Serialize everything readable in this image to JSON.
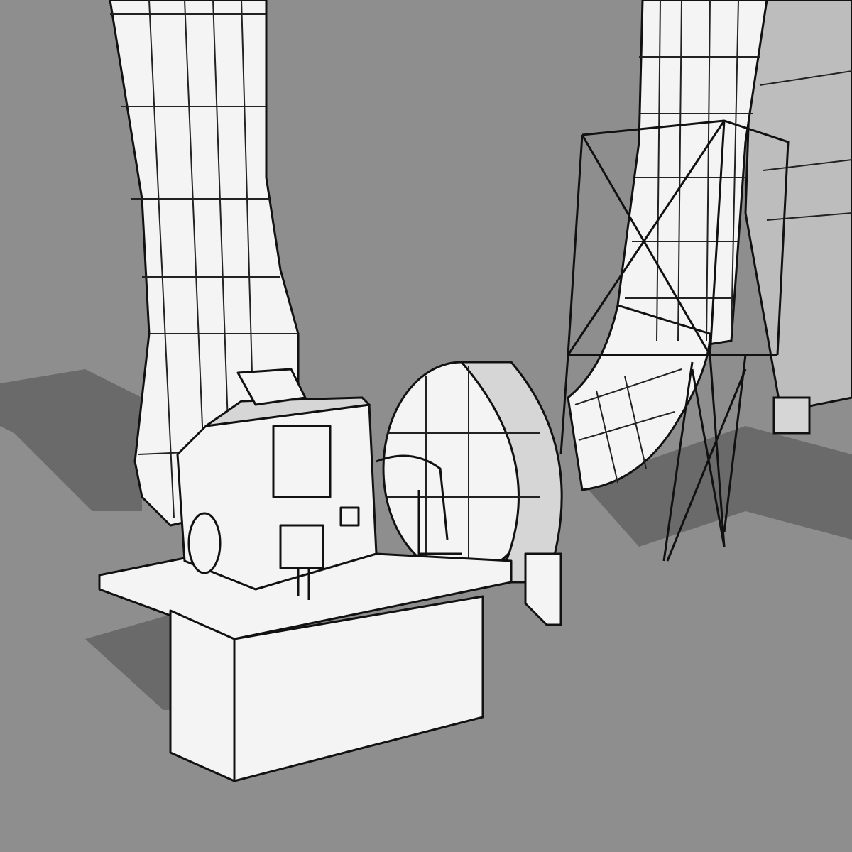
{
  "colors": {
    "background": "#8e8e8e",
    "shadow": "#6a6a6a",
    "surface": "#f4f4f4",
    "outline": "#111111"
  }
}
